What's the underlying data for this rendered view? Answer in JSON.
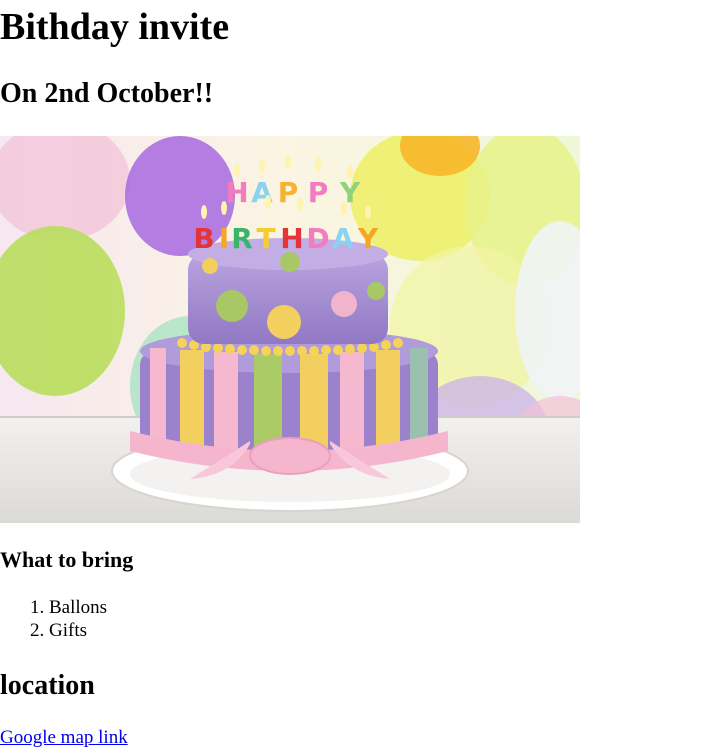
{
  "page": {
    "title": "Bithday invite",
    "date_heading": "On 2nd October!!",
    "image": {
      "candle_letters_row1": "HAPPY",
      "candle_letters_row2": "BIRTHDAY"
    },
    "bring_heading": "What to bring",
    "bring_items": [
      "Ballons",
      "Gifts"
    ],
    "location_heading": "location",
    "map_link": "Google map link"
  },
  "colors": {
    "link": "#0000ee",
    "cake_purple": "#a58bd0",
    "cake_pink": "#f3b4cf",
    "cake_yellow": "#f4d35e",
    "cake_green": "#a6c964"
  }
}
